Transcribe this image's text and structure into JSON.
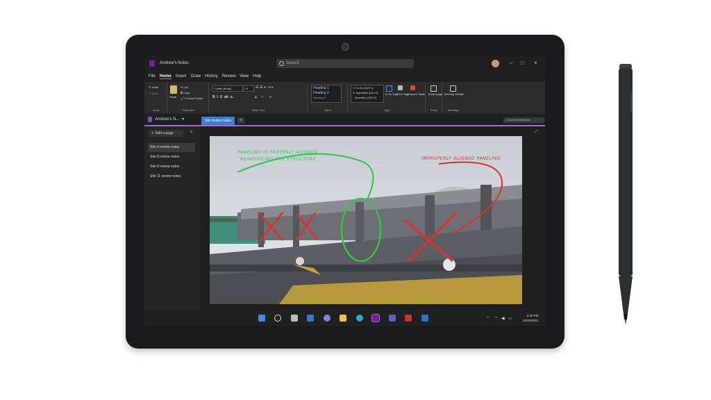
{
  "app": {
    "window_title": "Andrew's Notes",
    "search_placeholder": "Search"
  },
  "menu": {
    "items": [
      "File",
      "Home",
      "Insert",
      "Draw",
      "History",
      "Review",
      "View",
      "Help"
    ],
    "active": "Home"
  },
  "ribbon": {
    "undo": {
      "undo_label": "Undo",
      "redo_label": "Redo",
      "group_label": "Undo"
    },
    "clipboard": {
      "paste_label": "Paste",
      "cut_label": "Cut",
      "copy_label": "Copy",
      "format_painter_label": "Format Painter",
      "group_label": "Clipboard"
    },
    "basic_text": {
      "font_name": "Calibri (Body)",
      "font_size": "21",
      "group_label": "Basic Text"
    },
    "styles": {
      "heading1": "Heading 1",
      "heading2": "Heading 2",
      "heading3": "Heading 3",
      "group_label": "Styles"
    },
    "tags": {
      "items": [
        "To Do (Ctrl+1)",
        "Important (Ctrl+2)",
        "Question (Ctrl+3)"
      ],
      "todo_tag_label": "To Do Tag",
      "find_tags_label": "Find Tags",
      "custom_tags_label": "Custom Tasks",
      "group_label": "Tags"
    },
    "email": {
      "label": "Email page",
      "group_label": "Email"
    },
    "meetings": {
      "label": "Meeting Details",
      "group_label": "Meetings"
    }
  },
  "notebook": {
    "name": "Andrew's N...",
    "section_tab": "Site review notes",
    "search_notebooks": "Search notebooks",
    "add_page": "Add a page"
  },
  "pages": [
    {
      "label": "Site 4 review notes",
      "selected": true
    },
    {
      "label": "Site 8 review notes",
      "selected": false
    },
    {
      "label": "Site 9 review notes",
      "selected": false
    },
    {
      "label": "Site 11 review notes",
      "selected": false
    }
  ],
  "annotations": {
    "green_line1": "Paneling is properly aligned,",
    "green_line2": "reinforcing the structure",
    "red": "Improperly aligned paneling",
    "green_color": "#35c24a",
    "red_color": "#e0302a"
  },
  "taskbar": {
    "icons": [
      "windows-start",
      "search",
      "task-view",
      "widgets",
      "chat",
      "file-explorer",
      "edge",
      "onenote",
      "teams",
      "acrobat",
      "microsoft-store"
    ],
    "time": "2:30 PM",
    "date": "10/20/2021"
  },
  "colors": {
    "accent": "#a66bd3",
    "onenote": "#7719aa",
    "section_tab": "#3d7ec8"
  }
}
